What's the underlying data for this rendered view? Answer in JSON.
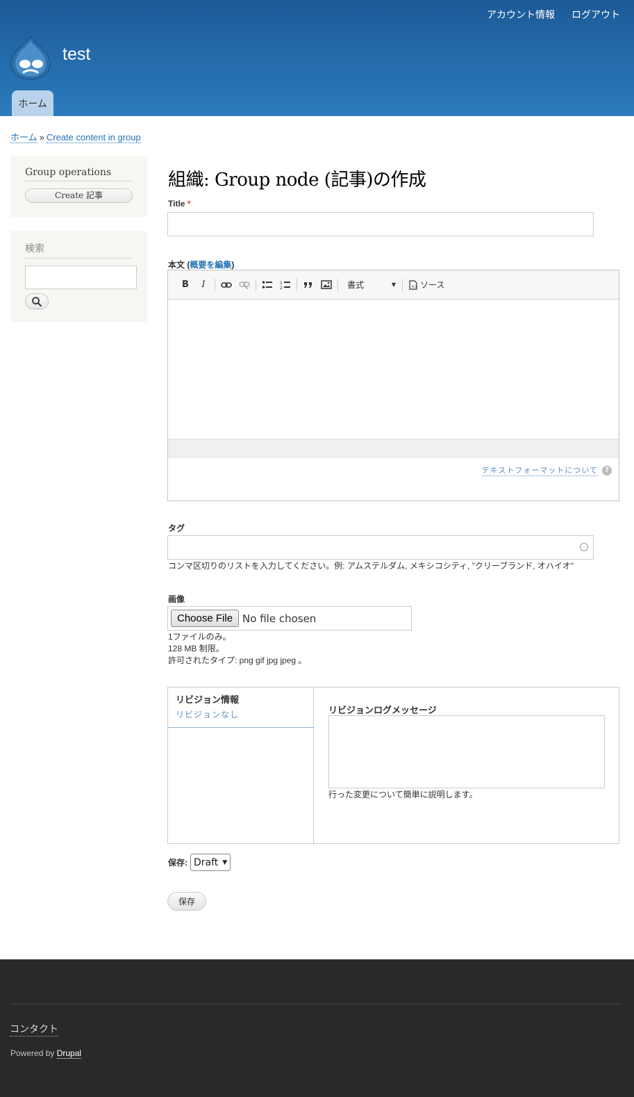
{
  "header": {
    "site_name": "test",
    "secondary_menu": [
      "アカウント情報",
      "ログアウト"
    ],
    "main_tab": "ホーム",
    "colors": {
      "header_top": "#1c5a97",
      "header_bottom": "#2c7bbd",
      "tab": "#b9d3ea"
    }
  },
  "breadcrumb": {
    "home": "ホーム",
    "separator": "»",
    "current": "Create content in group"
  },
  "sidebar": {
    "ops_title": "Group operations",
    "ops_button": "Create 記事",
    "search_title": "検索"
  },
  "main": {
    "page_title": "組織: Group node (記事)の作成",
    "title_label": "Title",
    "required_mark": "*",
    "body_label": "本文",
    "body_edit_summary": "概要を編集",
    "toolbar": {
      "bold": "B",
      "italic": "I",
      "format_label": "書式",
      "source_label": "ソース"
    },
    "text_format_help": "テキストフォーマットについて",
    "tags_label": "タグ",
    "tags_description": "コンマ区切りのリストを入力してください。例: アムステルダム, メキシコシティ, \"クリーブランド, オハイオ\"",
    "image_label": "画像",
    "file_button": "Choose File",
    "file_status": "No file chosen",
    "image_help": [
      "1ファイルのみ。",
      "128 MB 制限。",
      "許可されたタイプ: png gif jpg jpeg 。"
    ],
    "revision": {
      "tab_title": "リビジョン情報",
      "tab_summary": "リビジョンなし",
      "log_label": "リビジョンログメッセージ",
      "log_description": "行った変更について簡単に説明します。"
    },
    "save_state_label": "保存:",
    "save_state_value": "Draft",
    "submit_label": "保存"
  },
  "footer": {
    "contact": "コンタクト",
    "powered_by": "Powered by",
    "drupal": "Drupal"
  }
}
